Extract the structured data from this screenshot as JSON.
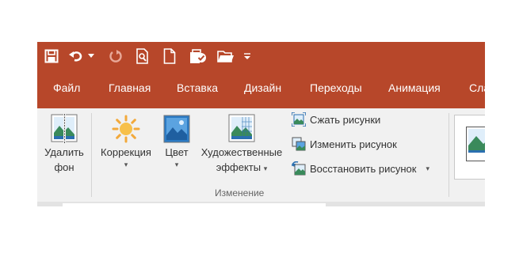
{
  "quick_access": {
    "icons": [
      "save-icon",
      "undo-icon",
      "redo-icon",
      "print-preview-icon",
      "new-file-icon",
      "check-in-icon",
      "open-folder-icon",
      "customize-dropdown-icon"
    ]
  },
  "tabs": [
    {
      "label": "Файл"
    },
    {
      "label": "Главная"
    },
    {
      "label": "Вставка"
    },
    {
      "label": "Дизайн"
    },
    {
      "label": "Переходы"
    },
    {
      "label": "Анимация"
    },
    {
      "label": "Сла"
    }
  ],
  "ribbon": {
    "remove_bg": {
      "line1": "Удалить",
      "line2": "фон"
    },
    "correction": {
      "label": "Коррекция",
      "caret": "▾"
    },
    "color": {
      "label": "Цвет",
      "caret": "▾"
    },
    "artistic": {
      "line1": "Художественные",
      "line2": "эффекты",
      "caret": "▾"
    },
    "small_buttons": [
      {
        "label": "Сжать рисунки",
        "icon": "compress-pictures-icon"
      },
      {
        "label": "Изменить рисунок",
        "icon": "change-picture-icon"
      },
      {
        "label": "Восстановить рисунок",
        "icon": "reset-picture-icon",
        "caret": "▾"
      }
    ],
    "group_label": "Изменение"
  },
  "colors": {
    "accent": "#b7472a",
    "ribbon_bg": "#f1f1f1"
  }
}
